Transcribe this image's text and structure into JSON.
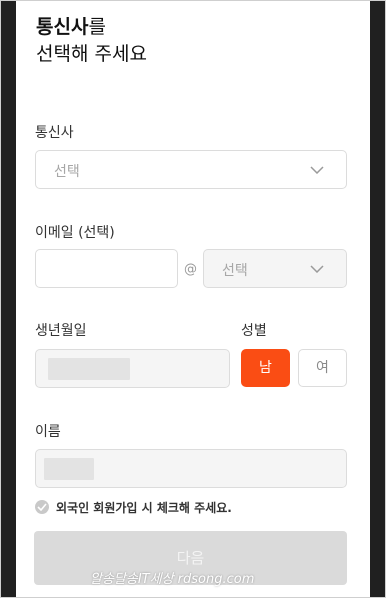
{
  "header": {
    "title_bold": "통신사",
    "title_tail": "를",
    "title_line2": "선택해 주세요"
  },
  "carrier": {
    "label": "통신사",
    "select_text": "선택"
  },
  "email": {
    "label": "이메일 (선택)",
    "id_value": "",
    "at": "@",
    "domain_text": "선택"
  },
  "birth": {
    "label": "생년월일"
  },
  "gender": {
    "label": "성별",
    "male": "남",
    "female": "여",
    "selected": "남"
  },
  "name": {
    "label": "이름"
  },
  "foreigner": {
    "label": "외국인 회원가입 시 체크해 주세요."
  },
  "next": {
    "label": "다음"
  },
  "watermark": {
    "text": "알송달송IT세상 rdsong.com"
  },
  "colors": {
    "accent": "#fa4d14",
    "disabled_button": "#dadada"
  }
}
